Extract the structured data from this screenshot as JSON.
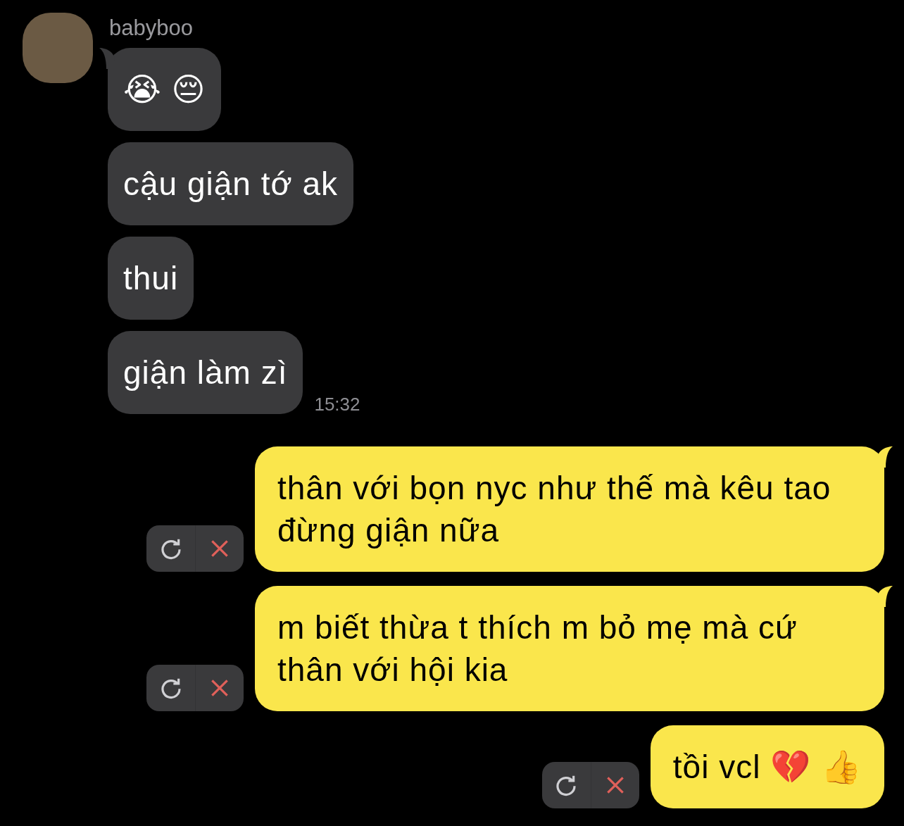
{
  "contact": {
    "name": "babyboo"
  },
  "incoming": [
    {
      "text": "😭 😔",
      "tail": true
    },
    {
      "text": "cậu giận tớ ak",
      "tail": false
    },
    {
      "text": "thui",
      "tail": false
    },
    {
      "text": "giận làm zì",
      "tail": false,
      "time": "15:32"
    }
  ],
  "outgoing": [
    {
      "text": "thân với bọn nyc như thế mà kêu tao đừng giận nữa",
      "tail": true,
      "failed": true
    },
    {
      "text": "m biết thừa t thích m bỏ mẹ mà cứ thân với hội kia",
      "tail": true,
      "failed": true
    },
    {
      "text": "tồi vcl 💔 👍",
      "tail": false,
      "failed": true
    }
  ]
}
